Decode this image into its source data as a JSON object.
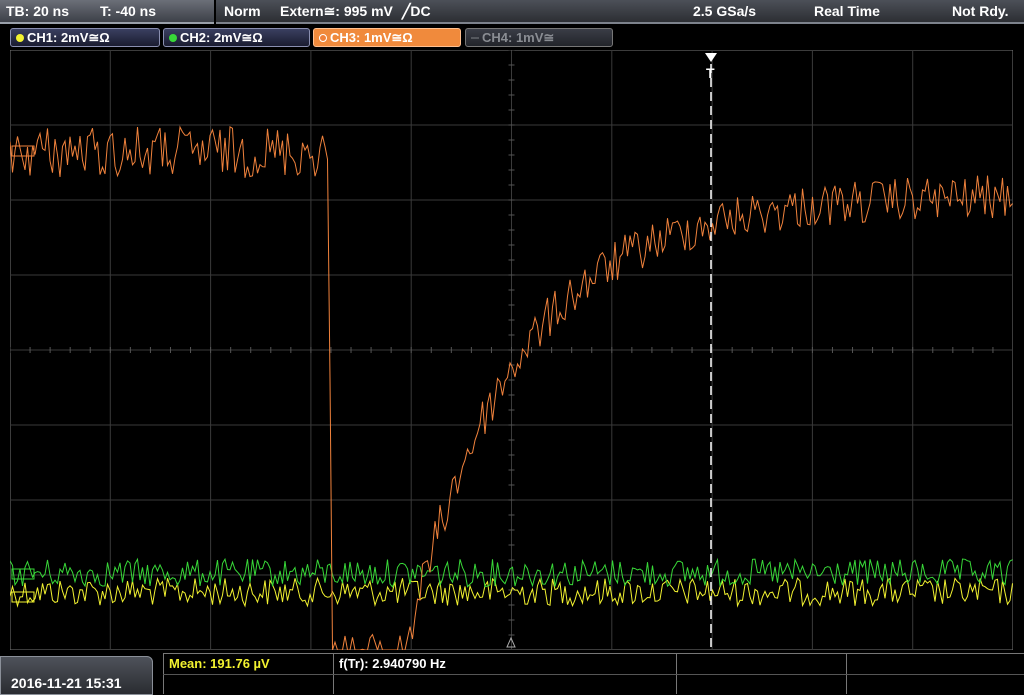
{
  "timebase": {
    "tb": "TB: 20 ns",
    "t": "T: -40 ns"
  },
  "trigger_bar": {
    "mode": "Norm",
    "source": "Extern≅: 995 mV",
    "coupling": "╱DC",
    "sample_rate": "2.5 GSa/s",
    "acq_mode": "Real Time",
    "status": "Not Rdy."
  },
  "channels": [
    {
      "label": "CH1: 2mV≅Ω",
      "color": "#f2f230"
    },
    {
      "label": "CH2: 2mV≅Ω",
      "color": "#38d838"
    },
    {
      "label": "CH3: 1mV≅Ω",
      "color": "#f0823c"
    },
    {
      "label": "CH4: 1mV≅",
      "color": "#6f7278"
    }
  ],
  "markers": {
    "trigger": "T"
  },
  "measurements": {
    "mean": "Mean: 191.76 µV",
    "freq": "f(Tr): 2.940790 Hz"
  },
  "datetime": "2016-11-21 15:31",
  "colors": {
    "grid": "#3a3a3a",
    "trigger_line": "#ffffff"
  }
}
